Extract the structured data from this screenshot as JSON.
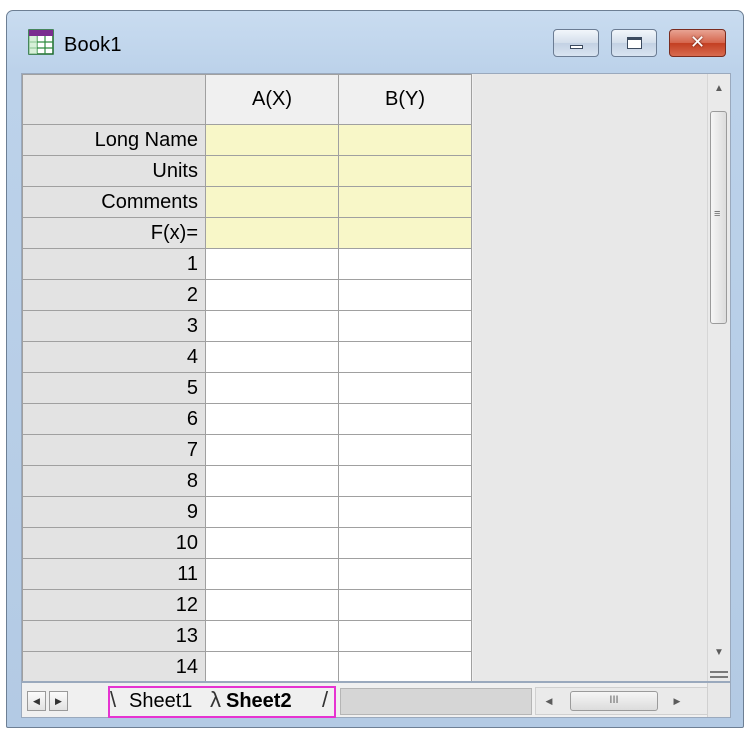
{
  "window": {
    "title": "Book1",
    "icons": {
      "app": "grid-workbook-icon",
      "minimize": "minimize-icon",
      "maximize": "maximize-icon",
      "close": "close-icon"
    },
    "close_glyph": "✕"
  },
  "grid": {
    "columns": [
      "A(X)",
      "B(Y)"
    ],
    "label_rows": [
      "Long Name",
      "Units",
      "Comments",
      "F(x)="
    ],
    "data_rows": [
      "1",
      "2",
      "3",
      "4",
      "5",
      "6",
      "7",
      "8",
      "9",
      "10",
      "11",
      "12",
      "13",
      "14"
    ]
  },
  "scrollbars": {
    "v_up_glyph": "▲",
    "v_down_glyph": "▼",
    "v_grip_glyph": "≡",
    "h_left_glyph": "◀",
    "h_right_glyph": "▶",
    "h_grip_glyph": "III"
  },
  "sheet_nav": {
    "prev_glyph": "◀",
    "next_glyph": "▶"
  },
  "sheet_tabs": [
    "Sheet1",
    "Sheet2"
  ],
  "colors": {
    "label_cell_bg": "#f8f7c8",
    "tab_highlight": "#e633d1",
    "close_button": "#c33f22"
  }
}
